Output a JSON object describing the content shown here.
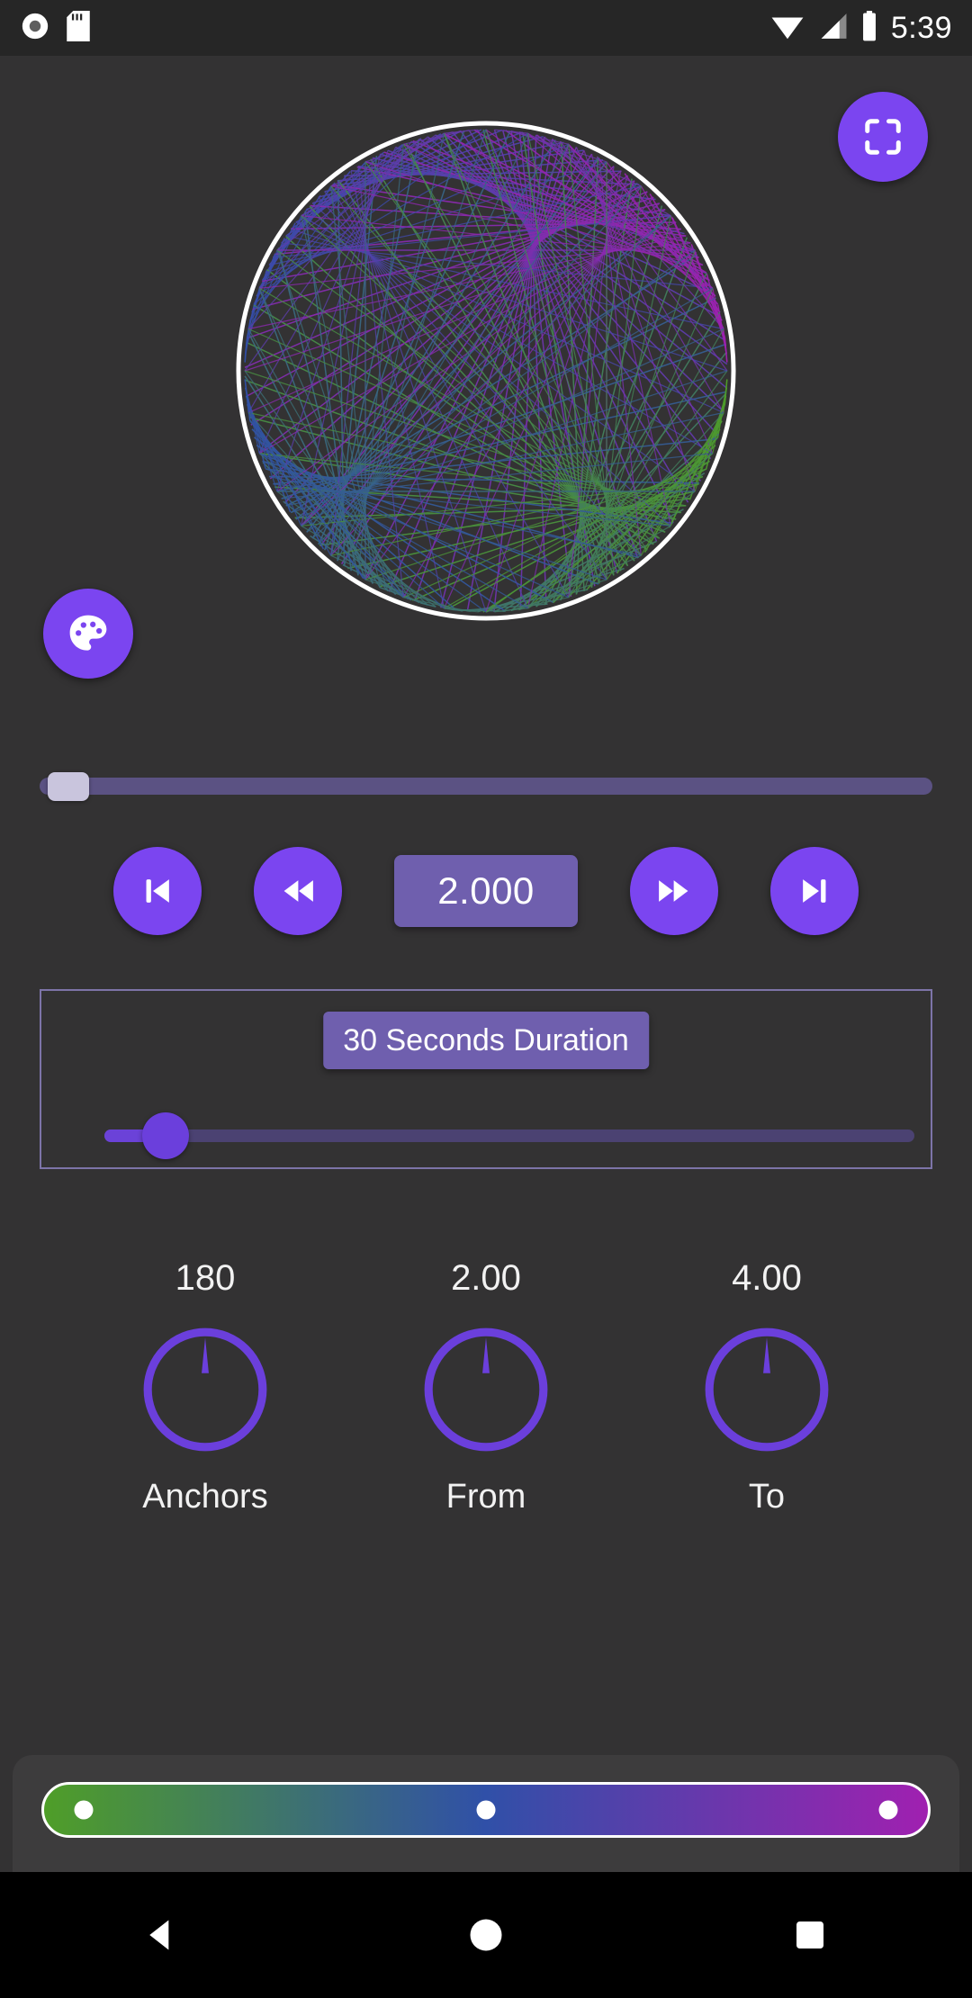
{
  "status_bar": {
    "time": "5:39",
    "icons": [
      "record-icon",
      "sd-card-icon",
      "wifi-icon",
      "cell-signal-icon",
      "battery-icon"
    ]
  },
  "theme": {
    "background": "#333233",
    "accent": "#7B45F0",
    "accent_muted": "#6F5FAE",
    "panel": "#3D3C3D",
    "text": "#f2f2f2"
  },
  "viewport": {
    "fullscreen_button": "fullscreen-icon",
    "palette_button": "palette-icon"
  },
  "progress": {
    "value_percent": 1
  },
  "transport": {
    "skip_previous_label": "skip-previous-icon",
    "rewind_label": "rewind-icon",
    "speed_value": "2.000",
    "forward_label": "fast-forward-icon",
    "skip_next_label": "skip-next-icon"
  },
  "duration": {
    "chip_label": "30 Seconds Duration",
    "slider_percent": 5
  },
  "knobs": [
    {
      "value": "180",
      "label": "Anchors",
      "angle": 0
    },
    {
      "value": "2.00",
      "label": "From",
      "angle": 0
    },
    {
      "value": "4.00",
      "label": "To",
      "angle": 0
    }
  ],
  "gradient": {
    "stops": [
      {
        "position_percent": 0,
        "color": "#4F9E28"
      },
      {
        "position_percent": 50,
        "color": "#3050A8"
      },
      {
        "position_percent": 100,
        "color": "#A020B0"
      }
    ]
  },
  "navigation": {
    "back": "back-icon",
    "home": "home-icon",
    "recents": "recents-icon"
  },
  "chart_data": {
    "type": "line",
    "title": "String art cardioid",
    "anchors": 180,
    "from_multiplier": 2.0,
    "to_multiplier": 4.0,
    "gradient_colors": [
      "#4F9E28",
      "#3050A8",
      "#A020B0"
    ],
    "outline_color": "#ffffff"
  }
}
